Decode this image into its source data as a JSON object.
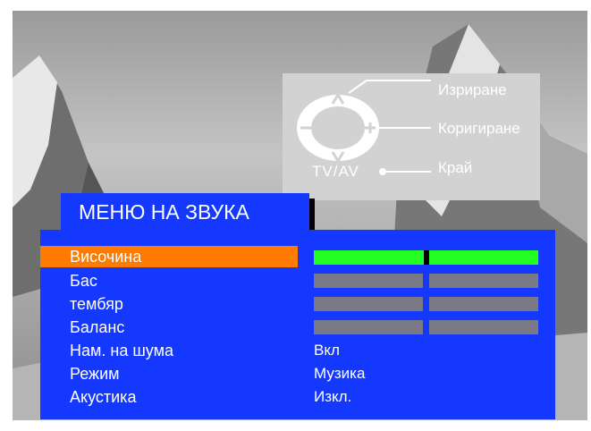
{
  "help": {
    "select_label": "Изриране",
    "adjust_label": "Коригиране",
    "exit_label": "Край",
    "tvav_label": "TV/AV"
  },
  "menu": {
    "title": "МЕНЮ НА ЗВУКА",
    "items": [
      {
        "label": "Височина",
        "selected": true
      },
      {
        "label": "Бас"
      },
      {
        "label": "тембяр"
      },
      {
        "label": "Баланс"
      },
      {
        "label": "Нам. на шума",
        "value": "Вкл"
      },
      {
        "label": "Режим",
        "value": "Музика"
      },
      {
        "label": "Акустика",
        "value": "Изкл."
      }
    ]
  },
  "levels": {
    "volume": 0.5,
    "bass": 0.5,
    "treble": 0.5,
    "balance": 0.5
  },
  "colors": {
    "menu_background": "#1538ff",
    "selected_row": "#ff7a00",
    "active_slider": "#22ff22",
    "inactive_slider": "#7a7a86",
    "help_panel": "#d2d2d2"
  }
}
